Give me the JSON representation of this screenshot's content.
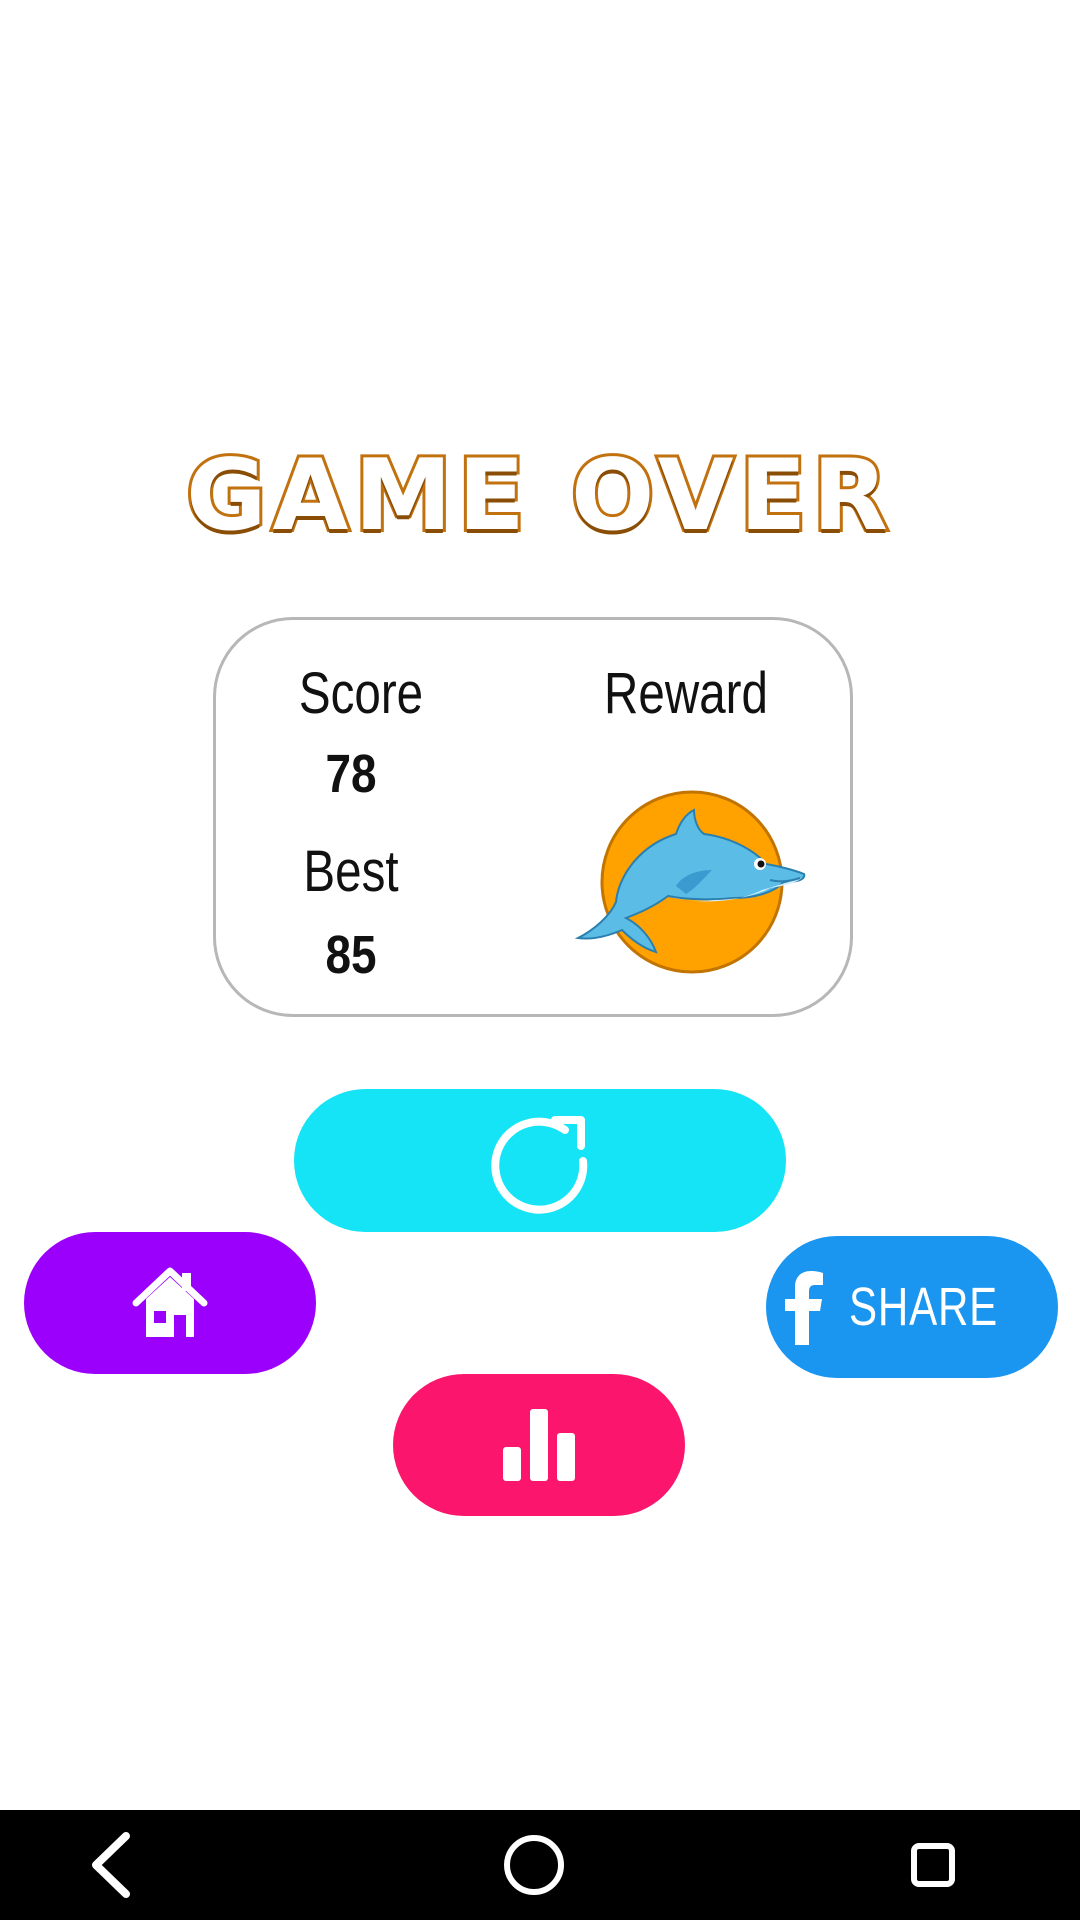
{
  "game_over": {
    "title": "GAME OVER"
  },
  "score_card": {
    "score_label": "Score",
    "score_value": "78",
    "best_label": "Best",
    "best_value": "85",
    "reward_label": "Reward",
    "reward_icon": "dolphin-medal-icon"
  },
  "buttons": {
    "restart_icon": "restart-icon",
    "home_icon": "home-icon",
    "share_icon": "facebook-icon",
    "share_label": "SHARE",
    "leaderboard_icon": "bar-chart-icon"
  },
  "colors": {
    "title_outline": "#c2710f",
    "restart_button": "#14e4f5",
    "home_button": "#9c00fd",
    "share_button": "#1a95f0",
    "leaderboard_button": "#fc156c",
    "reward_circle": "#ffa200",
    "dolphin": "#5bbde6"
  },
  "navbar": {
    "back_icon": "back-icon",
    "home_icon": "home-circle-icon",
    "recents_icon": "recents-icon"
  }
}
